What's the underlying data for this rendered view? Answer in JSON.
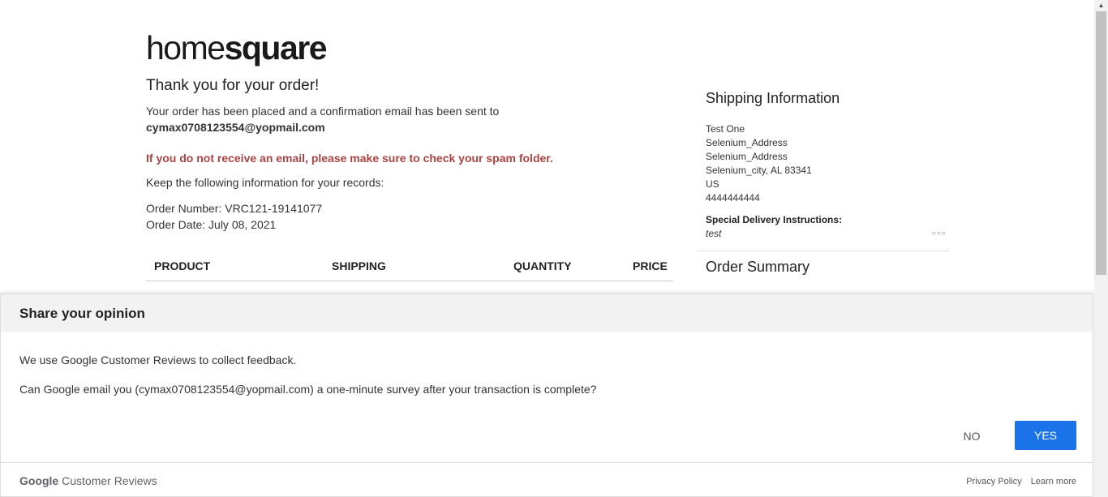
{
  "logo": {
    "part1": "home",
    "part2": "square"
  },
  "confirmation": {
    "thank_you": "Thank you for your order!",
    "placed_text": "Your order has been placed and a confirmation email has been sent to",
    "email": "cymax0708123554@yopmail.com",
    "spam_notice": "If you do not receive an email, please make sure to check your spam folder.",
    "keep_info": "Keep the following information for your records:",
    "order_number": "Order Number: VRC121-19141077",
    "order_date": "Order Date: July 08, 2021"
  },
  "product_table": {
    "headers": [
      "PRODUCT",
      "SHIPPING",
      "QUANTITY",
      "PRICE"
    ]
  },
  "shipping": {
    "title": "Shipping Information",
    "lines": [
      "Test One",
      "Selenium_Address",
      "Selenium_Address",
      "Selenium_city, AL 83341",
      "US",
      "4444444444"
    ],
    "special_label": "Special Delivery Instructions:",
    "special_value": "test",
    "more_icon": "ellipsis-icon"
  },
  "order_summary": {
    "title": "Order Summary"
  },
  "survey_dialog": {
    "title": "Share your opinion",
    "text1": "We use Google Customer Reviews to collect feedback.",
    "text2": "Can Google email you (cymax0708123554@yopmail.com) a one-minute survey after your transaction is complete?",
    "no_label": "NO",
    "yes_label": "YES",
    "brand_google": "Google",
    "brand_rest": "Customer Reviews",
    "privacy_label": "Privacy Policy",
    "learn_label": "Learn more",
    "yes_color": "#1a73e8"
  }
}
